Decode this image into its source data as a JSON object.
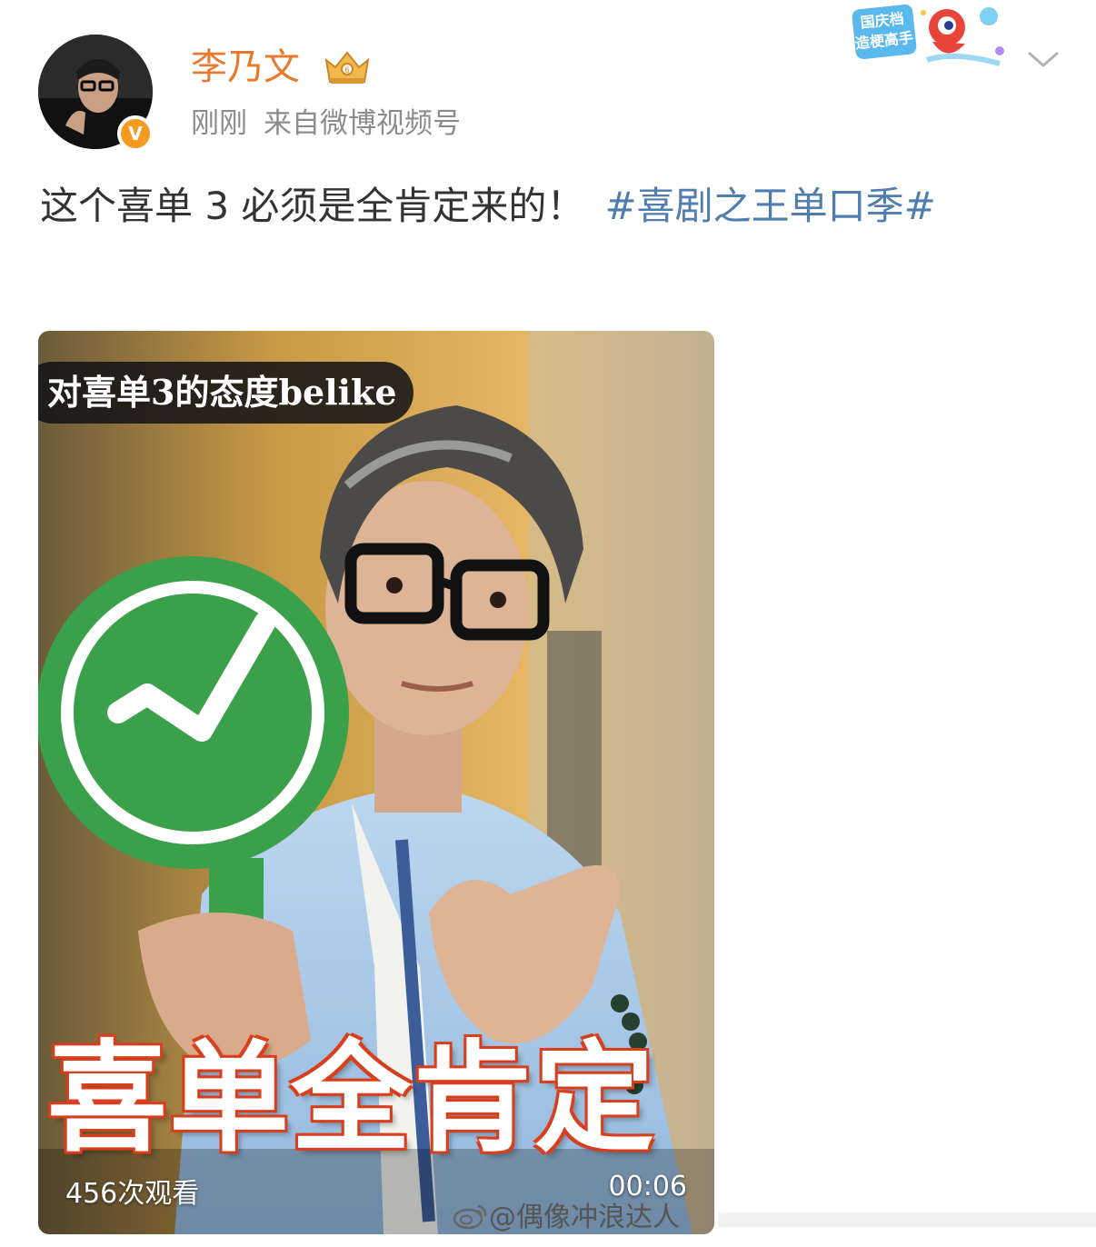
{
  "post": {
    "author": "李乃文",
    "time": "刚刚",
    "source": "来自微博视频号",
    "text": "这个喜单 3 必须是全肯定来的！",
    "hashtag": "#喜剧之王单口季#",
    "verified_mark": "V"
  },
  "badges": {
    "rank_icon": "crown-rank-badge-icon",
    "event_badge_text_line1": "国庆档",
    "event_badge_text_line2": "造梗高手"
  },
  "video": {
    "caption": "对喜单3的态度belike",
    "overlay_title": "喜单全肯定",
    "views": "456次观看",
    "duration": "00:06"
  },
  "watermark": {
    "text": "@偶像冲浪达人",
    "icon": "weibo-logo-icon"
  },
  "colors": {
    "username": "#e8792e",
    "hashtag": "#507daf",
    "meta": "#8c8c8c",
    "verified": "#f49b20",
    "sign_green": "#3aa04a",
    "title_outline": "#d8401f"
  }
}
